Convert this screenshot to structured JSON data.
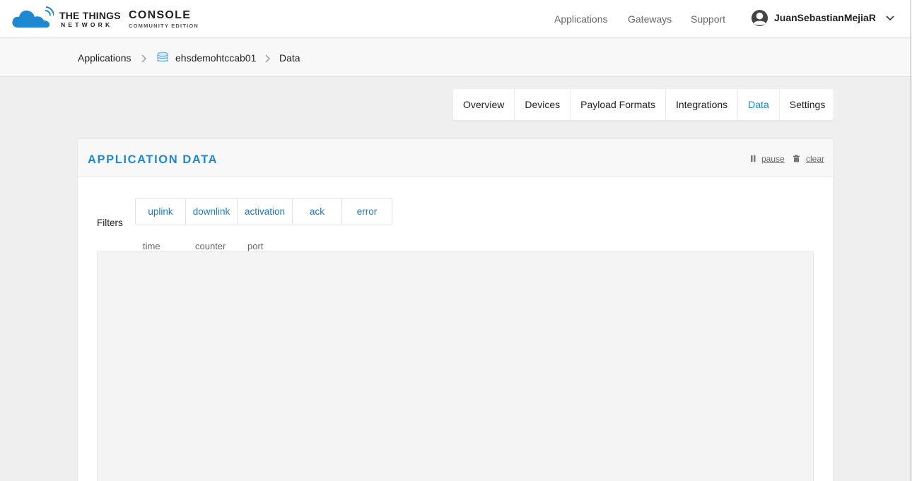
{
  "header": {
    "brand_main": "THE THINGS",
    "brand_sub": "NETWORK",
    "console_main": "CONSOLE",
    "console_sub": "COMMUNITY EDITION",
    "nav": [
      "Applications",
      "Gateways",
      "Support"
    ],
    "user": {
      "name": "JuanSebastianMejiaR"
    },
    "colors": {
      "brand_blue": "#1e88d3"
    }
  },
  "breadcrumb": {
    "items": [
      "Applications",
      "ehsdemohtccab01",
      "Data"
    ],
    "icons": [
      "chevron-right-icon",
      "layers-icon"
    ]
  },
  "tabs": {
    "items": [
      "Overview",
      "Devices",
      "Payload Formats",
      "Integrations",
      "Data",
      "Settings"
    ],
    "active": "Data"
  },
  "panel": {
    "title": "APPLICATION DATA",
    "pause_label": "pause",
    "clear_label": "clear",
    "filters_label": "Filters",
    "filters": [
      "uplink",
      "downlink",
      "activation",
      "ack",
      "error"
    ],
    "columns": [
      "time",
      "counter",
      "port"
    ]
  }
}
